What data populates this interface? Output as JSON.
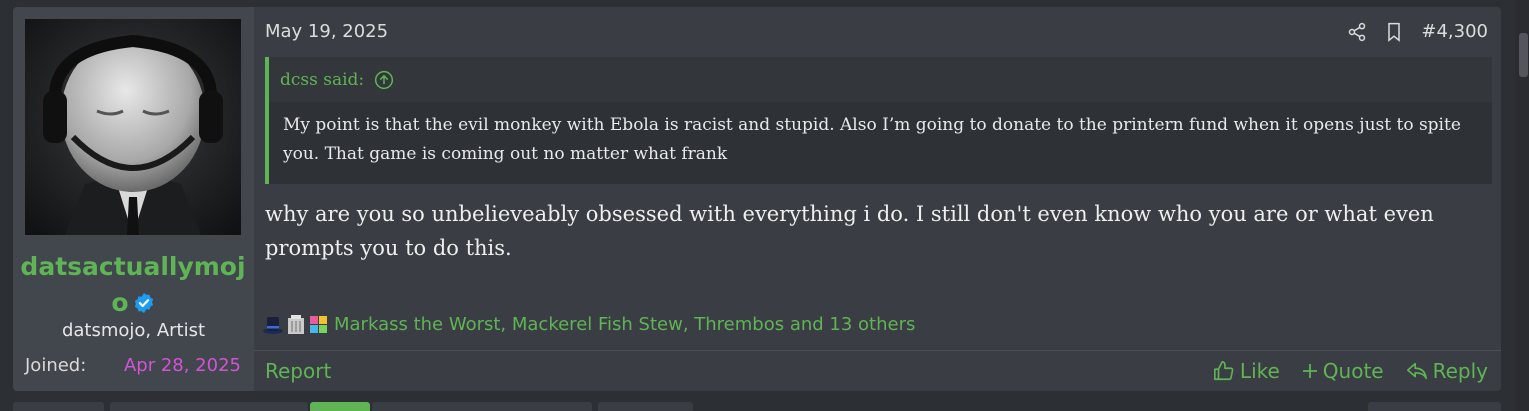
{
  "post": {
    "date": "May 19, 2025",
    "number": "#4,300",
    "user": {
      "name": "datsactuallymojo",
      "title": "datsmojo, Artist",
      "joined_label": "Joined:",
      "joined_date": "Apr 28, 2025"
    },
    "quote": {
      "author_line": "dcss said:",
      "text": "My point is that the evil monkey with Ebola is racist and stupid. Also I’m going to donate to the printern fund when it opens just to spite you. That game is coming out no matter what frank"
    },
    "message": "why are you so unbelieveably obsessed with everything i do. I still don't even know who you are or what even prompts you to do this.",
    "reactions": {
      "icons": [
        "top-hat-icon",
        "statue-icon",
        "puzzle-icon"
      ],
      "text": "Markass the Worst, Mackerel Fish Stew, Thrembos and 13 others"
    },
    "footer": {
      "report": "Report",
      "like": "Like",
      "quote": "Quote",
      "reply": "Reply"
    }
  },
  "colors": {
    "accent_green": "#5fb455",
    "joined_date": "#d254d6",
    "verified_blue": "#1d9bf0"
  },
  "icons": {
    "share": "share-icon",
    "bookmark": "bookmark-icon",
    "quote_jump": "arrow-up-circle-icon",
    "like": "thumbs-up-icon",
    "quote": "plus-icon",
    "reply": "reply-icon",
    "verified": "verified-badge-icon"
  }
}
